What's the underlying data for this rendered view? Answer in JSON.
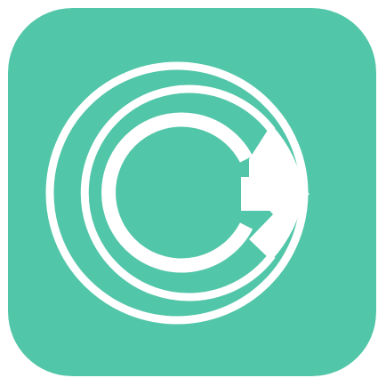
{
  "icon": {
    "name": "circular-arrow-logo",
    "background_color": "#52C6A8",
    "foreground_color": "#FFFFFF"
  }
}
